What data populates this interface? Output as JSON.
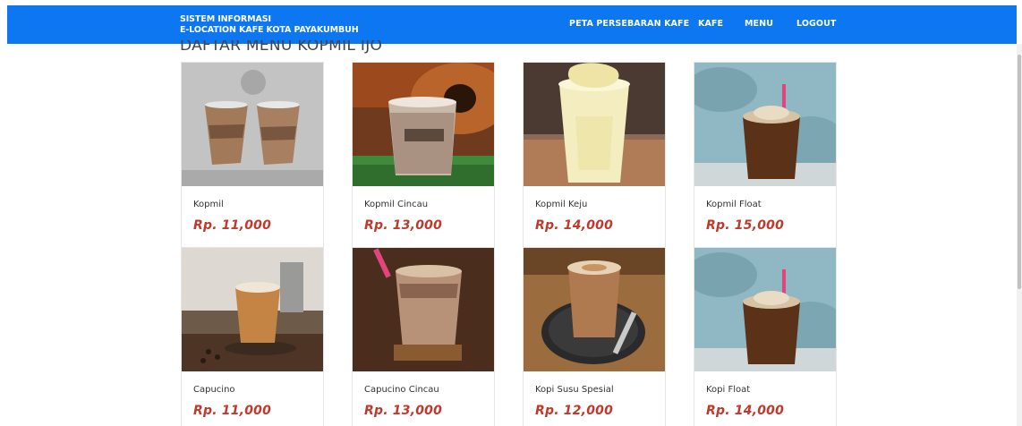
{
  "header": {
    "brand_line1": "SISTEM INFORMASI",
    "brand_line2": "E-LOCATION KAFE KOTA PAYAKUMBUH",
    "nav": [
      "PETA PERSEBARAN KAFE",
      "KAFE",
      "MENU",
      "LOGOUT"
    ]
  },
  "page_title": "DAFTAR MENU KOPMIL IJO",
  "colors": {
    "navbar": "#0d77f2",
    "price": "#c0392b"
  },
  "menu": [
    {
      "name": "Kopmil",
      "price": "Rp. 11,000"
    },
    {
      "name": "Kopmil Cincau",
      "price": "Rp. 13,000"
    },
    {
      "name": "Kopmil Keju",
      "price": "Rp. 14,000"
    },
    {
      "name": "Kopmil Float",
      "price": "Rp. 15,000"
    },
    {
      "name": "Capucino",
      "price": "Rp. 11,000"
    },
    {
      "name": "Capucino Cincau",
      "price": "Rp. 13,000"
    },
    {
      "name": "Kopi Susu Spesial",
      "price": "Rp. 12,000"
    },
    {
      "name": "Kopi Float",
      "price": "Rp. 14,000"
    }
  ]
}
